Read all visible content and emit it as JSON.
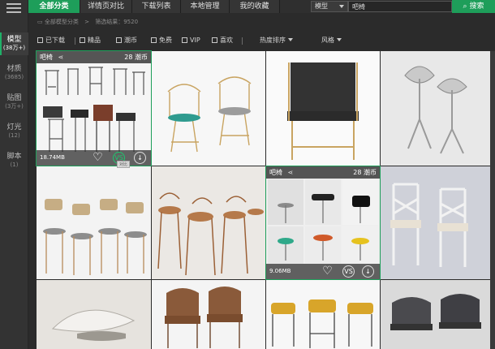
{
  "sidebar": {
    "items": [
      {
        "name": "模型",
        "count": "(38万+)"
      },
      {
        "name": "材质",
        "count": "(3685)"
      },
      {
        "name": "贴图",
        "count": "(3万+)"
      },
      {
        "name": "灯光",
        "count": "(12)"
      },
      {
        "name": "脚本",
        "count": "(1)"
      }
    ]
  },
  "topbar": {
    "tabs": [
      "全部分类",
      "详情页对比",
      "下载列表",
      "本地管理",
      "我的收藏"
    ],
    "search_category": "模型",
    "search_value": "吧椅",
    "search_button": "搜索"
  },
  "breadcrumb": {
    "root": "全部模型分类",
    "separator": ">",
    "result": "筛选结果：9520"
  },
  "filters": {
    "downloaded": "已下载",
    "premium": "精品",
    "coins": "潮币",
    "free": "免费",
    "vip": "VIP",
    "liked": "喜欢",
    "sort": "热度排序",
    "style": "风格"
  },
  "cards": {
    "card1": {
      "title": "吧椅",
      "price": "28 潮币",
      "size": "18.74MB",
      "compare": "VS",
      "tooltip": "对比"
    },
    "card2": {
      "title": "吧椅",
      "price": "28 潮币",
      "size": "9.06MB",
      "compare": "VS"
    }
  },
  "icons": {
    "share": "share-icon",
    "heart": "heart-icon",
    "download": "download-icon"
  },
  "colors": {
    "accent": "#1e9e5a",
    "background": "#2b2b2b"
  }
}
